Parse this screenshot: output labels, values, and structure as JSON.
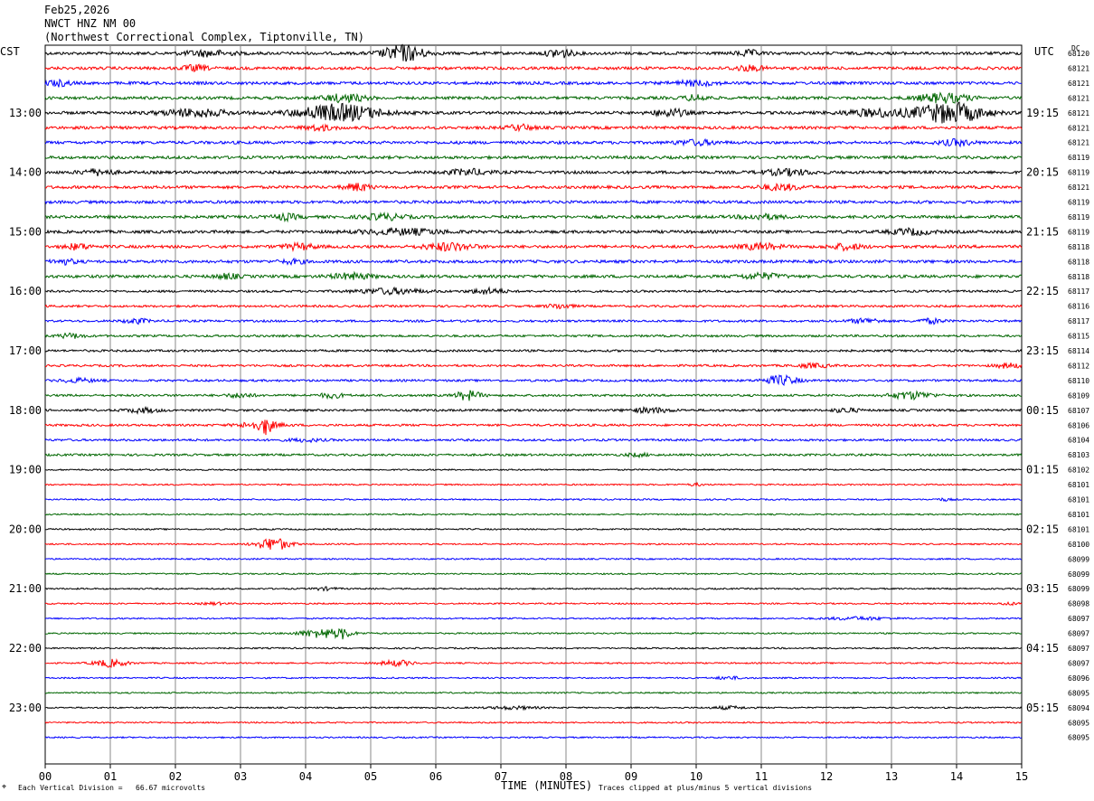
{
  "header": {
    "date": "Feb25,2026",
    "station": "NWCT HNZ NM 00",
    "location": "(Northwest Correctional Complex, Tiptonville, TN)"
  },
  "left_tz": "CST",
  "right_tz": "UTC",
  "dc_label": "DC",
  "footer": {
    "scale_note": "Each Vertical Division =   66.67 microvolts",
    "clip_note": "Traces clipped at plus/minus 5 vertical divisions",
    "corner_mark": "⌖"
  },
  "chart_data": {
    "type": "line",
    "xlabel": "TIME (MINUTES)",
    "x_ticks": [
      "00",
      "01",
      "02",
      "03",
      "04",
      "05",
      "06",
      "07",
      "08",
      "09",
      "10",
      "11",
      "12",
      "13",
      "14",
      "15"
    ],
    "xlim": [
      0,
      15
    ],
    "trace_colors": [
      "#000000",
      "#ff0000",
      "#0000ff",
      "#006600"
    ],
    "left_hour_labels": [
      "13:00",
      "14:00",
      "15:00",
      "16:00",
      "17:00",
      "18:00",
      "19:00",
      "20:00",
      "21:00",
      "22:00",
      "23:00"
    ],
    "right_hour_labels": [
      "19:15",
      "20:15",
      "21:15",
      "22:15",
      "23:15",
      "00:15",
      "01:15",
      "02:15",
      "03:15",
      "04:15",
      "05:15"
    ],
    "hour_label_row_start": 4,
    "rows_per_hour": 4,
    "dc_offsets": [
      "68120",
      "68121",
      "68121",
      "68121",
      "68121",
      "68121",
      "68121",
      "68119",
      "68119",
      "68121",
      "68119",
      "68119",
      "68119",
      "68118",
      "68118",
      "68118",
      "68117",
      "68116",
      "68117",
      "68115",
      "68114",
      "68112",
      "68110",
      "68109",
      "68107",
      "68106",
      "68104",
      "68103",
      "68102",
      "68101",
      "68101",
      "68101",
      "68101",
      "68100",
      "68099",
      "68099",
      "68099",
      "68098",
      "68097",
      "68097",
      "68097",
      "68097",
      "68096",
      "68095",
      "68094",
      "68095",
      "68095"
    ],
    "events": [
      {
        "row": 0,
        "minute": 5.5,
        "amp": 9,
        "width": 0.5
      },
      {
        "row": 0,
        "minute": 7.9,
        "amp": 5,
        "width": 0.3
      },
      {
        "row": 0,
        "minute": 10.8,
        "amp": 3,
        "width": 0.3
      },
      {
        "row": 0,
        "minute": 2.5,
        "amp": 3,
        "width": 0.6
      },
      {
        "row": 1,
        "minute": 2.3,
        "amp": 3,
        "width": 0.3
      },
      {
        "row": 1,
        "minute": 10.8,
        "amp": 2.5,
        "width": 0.4
      },
      {
        "row": 2,
        "minute": 0.2,
        "amp": 3,
        "width": 0.3
      },
      {
        "row": 2,
        "minute": 10,
        "amp": 2.5,
        "width": 0.5
      },
      {
        "row": 3,
        "minute": 4.6,
        "amp": 4,
        "width": 0.5
      },
      {
        "row": 3,
        "minute": 10,
        "amp": 3,
        "width": 0.3
      },
      {
        "row": 3,
        "minute": 13.8,
        "amp": 5,
        "width": 0.6
      },
      {
        "row": 4,
        "minute": 4.5,
        "amp": 9,
        "width": 1.0
      },
      {
        "row": 4,
        "minute": 2.3,
        "amp": 4,
        "width": 0.8
      },
      {
        "row": 4,
        "minute": 9.6,
        "amp": 4,
        "width": 0.4
      },
      {
        "row": 4,
        "minute": 13.9,
        "amp": 11,
        "width": 0.8
      },
      {
        "row": 4,
        "minute": 12.8,
        "amp": 4,
        "width": 0.8
      },
      {
        "row": 5,
        "minute": 7.3,
        "amp": 3,
        "width": 0.3
      },
      {
        "row": 5,
        "minute": 4.2,
        "amp": 2.5,
        "width": 0.4
      },
      {
        "row": 6,
        "minute": 14,
        "amp": 3,
        "width": 0.4
      },
      {
        "row": 6,
        "minute": 10,
        "amp": 2.5,
        "width": 0.5
      },
      {
        "row": 8,
        "minute": 0.8,
        "amp": 3,
        "width": 0.4
      },
      {
        "row": 8,
        "minute": 6.5,
        "amp": 3,
        "width": 0.5
      },
      {
        "row": 8,
        "minute": 11.4,
        "amp": 3,
        "width": 0.6
      },
      {
        "row": 9,
        "minute": 4.8,
        "amp": 4,
        "width": 0.3
      },
      {
        "row": 9,
        "minute": 11.3,
        "amp": 3,
        "width": 0.5
      },
      {
        "row": 11,
        "minute": 3.7,
        "amp": 3,
        "width": 0.3
      },
      {
        "row": 11,
        "minute": 5.2,
        "amp": 3,
        "width": 0.5
      },
      {
        "row": 11,
        "minute": 11,
        "amp": 2.5,
        "width": 0.5
      },
      {
        "row": 12,
        "minute": 5.5,
        "amp": 3,
        "width": 1.0
      },
      {
        "row": 12,
        "minute": 13.3,
        "amp": 3,
        "width": 0.5
      },
      {
        "row": 13,
        "minute": 0.5,
        "amp": 3,
        "width": 0.3
      },
      {
        "row": 13,
        "minute": 6.2,
        "amp": 4,
        "width": 0.6
      },
      {
        "row": 13,
        "minute": 3.9,
        "amp": 3,
        "width": 0.4
      },
      {
        "row": 13,
        "minute": 12.3,
        "amp": 3,
        "width": 0.4
      },
      {
        "row": 13,
        "minute": 11,
        "amp": 3,
        "width": 0.5
      },
      {
        "row": 14,
        "minute": 0.3,
        "amp": 2.5,
        "width": 0.3
      },
      {
        "row": 14,
        "minute": 3.8,
        "amp": 2,
        "width": 0.3
      },
      {
        "row": 15,
        "minute": 4.7,
        "amp": 3,
        "width": 0.5
      },
      {
        "row": 15,
        "minute": 11,
        "amp": 3,
        "width": 0.5
      },
      {
        "row": 15,
        "minute": 2.8,
        "amp": 2.5,
        "width": 0.3
      },
      {
        "row": 16,
        "minute": 5.3,
        "amp": 3,
        "width": 0.8
      },
      {
        "row": 16,
        "minute": 6.8,
        "amp": 3,
        "width": 0.4
      },
      {
        "row": 17,
        "minute": 7.9,
        "amp": 2.5,
        "width": 0.3
      },
      {
        "row": 18,
        "minute": 1.4,
        "amp": 2.5,
        "width": 0.3
      },
      {
        "row": 18,
        "minute": 12.6,
        "amp": 2.5,
        "width": 0.4
      },
      {
        "row": 18,
        "minute": 13.6,
        "amp": 2.5,
        "width": 0.3
      },
      {
        "row": 19,
        "minute": 0.4,
        "amp": 2.5,
        "width": 0.3
      },
      {
        "row": 21,
        "minute": 14.8,
        "amp": 2.5,
        "width": 0.3
      },
      {
        "row": 21,
        "minute": 11.8,
        "amp": 2,
        "width": 0.4
      },
      {
        "row": 22,
        "minute": 11.3,
        "amp": 5,
        "width": 0.4
      },
      {
        "row": 22,
        "minute": 0.5,
        "amp": 2,
        "width": 0.4
      },
      {
        "row": 23,
        "minute": 6.5,
        "amp": 5,
        "width": 0.3
      },
      {
        "row": 23,
        "minute": 3,
        "amp": 2.5,
        "width": 0.3
      },
      {
        "row": 23,
        "minute": 4.4,
        "amp": 2.5,
        "width": 0.3
      },
      {
        "row": 23,
        "minute": 13.3,
        "amp": 4,
        "width": 0.5
      },
      {
        "row": 24,
        "minute": 1.5,
        "amp": 2.5,
        "width": 0.4
      },
      {
        "row": 24,
        "minute": 9.3,
        "amp": 2.5,
        "width": 0.5
      },
      {
        "row": 24,
        "minute": 12.3,
        "amp": 2.5,
        "width": 0.3
      },
      {
        "row": 25,
        "minute": 3.3,
        "amp": 4,
        "width": 0.5
      },
      {
        "row": 25,
        "minute": 3.4,
        "amp": 8,
        "width": 0.1
      },
      {
        "row": 26,
        "minute": 4,
        "amp": 1.5,
        "width": 0.4
      },
      {
        "row": 27,
        "minute": 9.1,
        "amp": 1.5,
        "width": 0.3
      },
      {
        "row": 29,
        "minute": 10,
        "amp": 1.2,
        "width": 0.2
      },
      {
        "row": 30,
        "minute": 13.8,
        "amp": 1.2,
        "width": 0.2
      },
      {
        "row": 33,
        "minute": 3.5,
        "amp": 7,
        "width": 0.4
      },
      {
        "row": 36,
        "minute": 4.3,
        "amp": 1.5,
        "width": 0.3
      },
      {
        "row": 37,
        "minute": 14.8,
        "amp": 1.5,
        "width": 0.2
      },
      {
        "row": 37,
        "minute": 2.6,
        "amp": 1.2,
        "width": 0.3
      },
      {
        "row": 38,
        "minute": 12.5,
        "amp": 1.5,
        "width": 0.8
      },
      {
        "row": 39,
        "minute": 4.3,
        "amp": 5,
        "width": 0.6
      },
      {
        "row": 39,
        "minute": 4.6,
        "amp": 4,
        "width": 0.1
      },
      {
        "row": 41,
        "minute": 1,
        "amp": 4,
        "width": 0.4
      },
      {
        "row": 41,
        "minute": 5.4,
        "amp": 3,
        "width": 0.4
      },
      {
        "row": 42,
        "minute": 10.5,
        "amp": 1.5,
        "width": 0.3
      },
      {
        "row": 44,
        "minute": 7.2,
        "amp": 1.5,
        "width": 0.6
      },
      {
        "row": 44,
        "minute": 10.5,
        "amp": 1.5,
        "width": 0.4
      }
    ]
  }
}
